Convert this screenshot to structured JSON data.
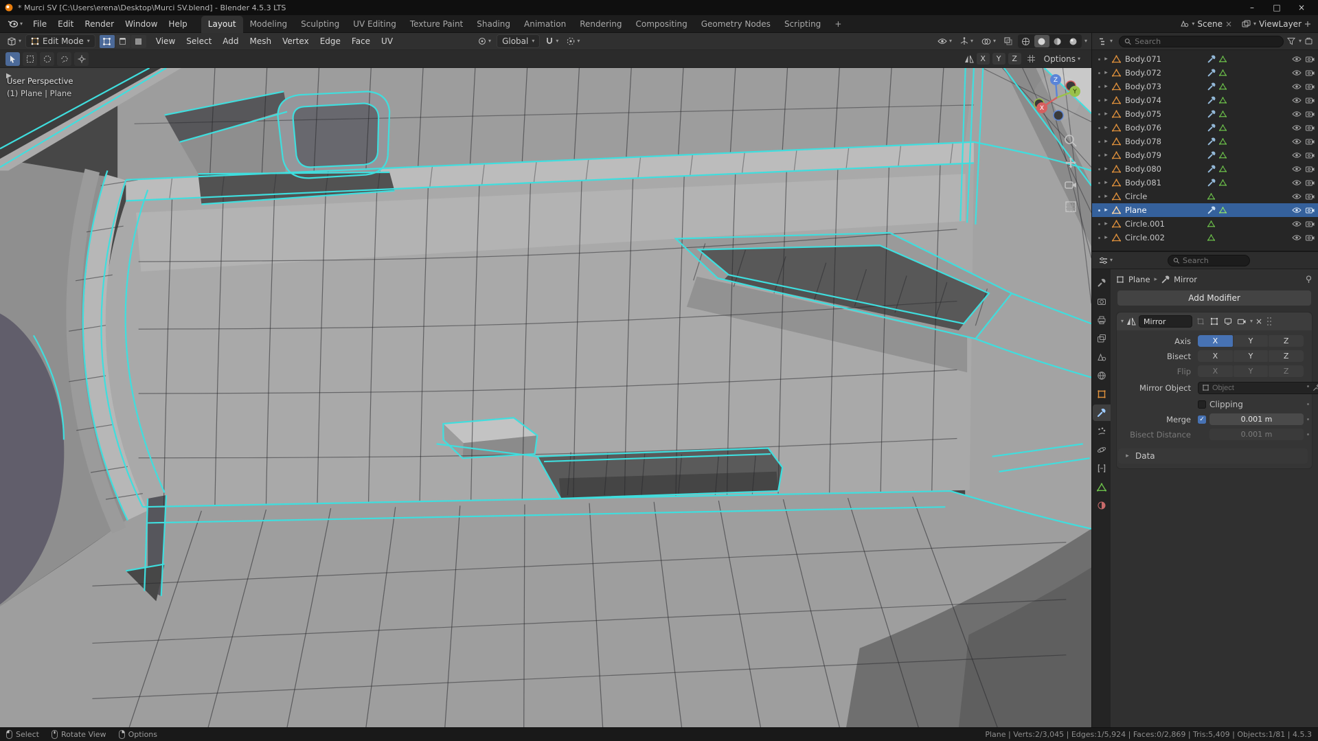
{
  "colors": {
    "accent_blue": "#4772b3",
    "selected_edge_cyan": "#3fdede",
    "object_orange": "#e0913c",
    "mesh_data_green": "#6cc04a"
  },
  "titlebar": {
    "title": "* Murci SV [C:\\Users\\erena\\Desktop\\Murci SV.blend] - Blender 4.5.3 LTS",
    "minimize": "–",
    "maximize": "□",
    "close": "×"
  },
  "menubar": {
    "menus": [
      "File",
      "Edit",
      "Render",
      "Window",
      "Help"
    ],
    "workspaces": [
      "Layout",
      "Modeling",
      "Sculpting",
      "UV Editing",
      "Texture Paint",
      "Shading",
      "Animation",
      "Rendering",
      "Compositing",
      "Geometry Nodes",
      "Scripting"
    ],
    "add_workspace": "+",
    "scene_label": "Scene",
    "viewlayer_label": "ViewLayer"
  },
  "viewport_header": {
    "mode": "Edit Mode",
    "menus": [
      "View",
      "Select",
      "Add",
      "Mesh",
      "Vertex",
      "Edge",
      "Face",
      "UV"
    ],
    "orientation": "Global",
    "options_label": "Options",
    "mirror_axes": [
      "X",
      "Y",
      "Z"
    ]
  },
  "viewport": {
    "perspective_label": "User Perspective",
    "object_label": "(1) Plane | Plane",
    "gizmo_axes": {
      "x": "X",
      "y": "Y",
      "z": "Z"
    }
  },
  "outliner": {
    "search_placeholder": "Search",
    "items": [
      {
        "label": "Body.071"
      },
      {
        "label": "Body.072"
      },
      {
        "label": "Body.073"
      },
      {
        "label": "Body.074"
      },
      {
        "label": "Body.075"
      },
      {
        "label": "Body.076"
      },
      {
        "label": "Body.078"
      },
      {
        "label": "Body.079"
      },
      {
        "label": "Body.080"
      },
      {
        "label": "Body.081"
      },
      {
        "label": "Circle"
      },
      {
        "label": "Plane",
        "selected": true
      },
      {
        "label": "Circle.001"
      },
      {
        "label": "Circle.002"
      }
    ]
  },
  "properties": {
    "search_placeholder": "Search",
    "breadcrumb": {
      "object": "Plane",
      "modifier": "Mirror"
    },
    "add_modifier_label": "Add Modifier",
    "modifier": {
      "name": "Mirror",
      "axis": {
        "label": "Axis",
        "options": [
          "X",
          "Y",
          "Z"
        ],
        "active": "X"
      },
      "bisect": {
        "label": "Bisect",
        "options": [
          "X",
          "Y",
          "Z"
        ]
      },
      "flip": {
        "label": "Flip",
        "options": [
          "X",
          "Y",
          "Z"
        ]
      },
      "mirror_object": {
        "label": "Mirror Object",
        "placeholder": "Object"
      },
      "clipping": {
        "label": "Clipping",
        "checked": false
      },
      "merge": {
        "label": "Merge",
        "checked": true,
        "value": "0.001 m"
      },
      "bisect_distance": {
        "label": "Bisect Distance",
        "value": "0.001 m"
      },
      "data_panel_label": "Data"
    }
  },
  "statusbar": {
    "hints": [
      {
        "button": "LMB",
        "label": "Select"
      },
      {
        "button": "MMB",
        "label": "Rotate View"
      },
      {
        "button": "RMB",
        "label": "Options"
      }
    ],
    "stats": "Plane | Verts:2/3,045 | Edges:1/5,924 | Faces:0/2,869 | Tris:5,409 | Objects:1/81 | 4.5.3"
  }
}
